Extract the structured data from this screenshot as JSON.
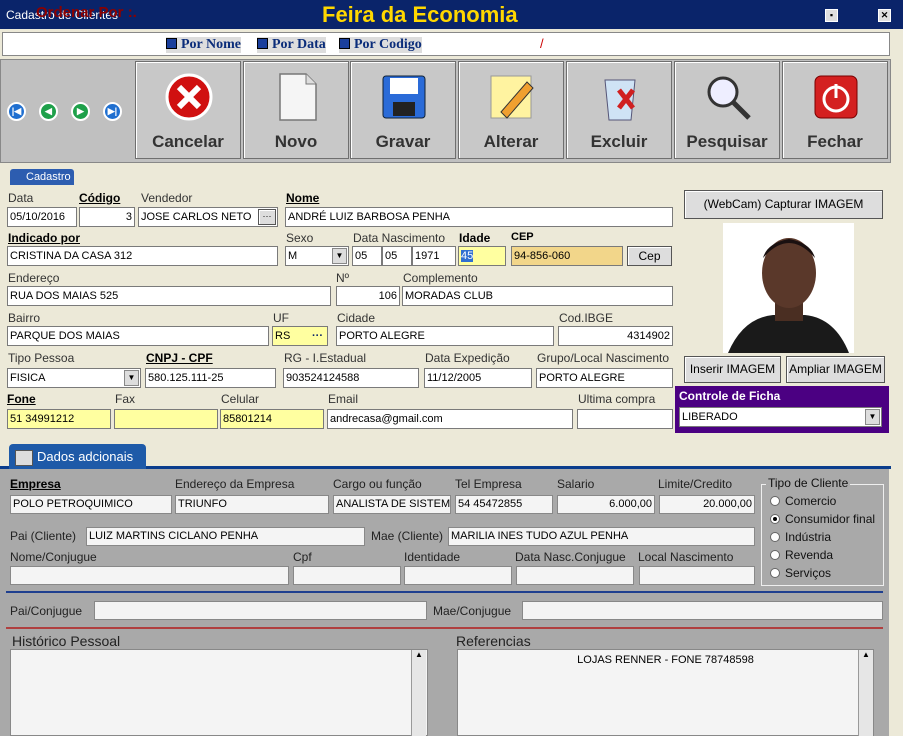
{
  "window": {
    "title": "Cadastro de Clientes",
    "banner": "Feira da Economia",
    "btn_restore": "▪",
    "btn_close": "✕"
  },
  "order": {
    "label": "Ordenar  Por :.",
    "options": [
      "Por Nome",
      "Por Data",
      "Por Codigo"
    ],
    "slash": "/"
  },
  "nav": {
    "first": "|◀",
    "prev": "◀",
    "next": "▶",
    "last": "▶|"
  },
  "toolbar": {
    "cancel": "Cancelar",
    "new": "Novo",
    "save": "Gravar",
    "edit": "Alterar",
    "delete": "Excluir",
    "search": "Pesquisar",
    "close": "Fechar"
  },
  "tab1": "Cadastro",
  "form": {
    "data_label": "Data",
    "data": "05/10/2016",
    "codigo_label": "Código",
    "codigo": "3",
    "vendedor_label": "Vendedor",
    "vendedor": "JOSE CARLOS NETO",
    "ellipsis": "···",
    "nome_label": "Nome",
    "nome": "ANDRÉ LUIZ BARBOSA PENHA",
    "indicado_label": "Indicado por",
    "indicado": "CRISTINA DA CASA 312",
    "sexo_label": "Sexo",
    "sexo": "M",
    "nasc_label": "Data Nascimento",
    "nasc_d": "05",
    "nasc_m": "05",
    "nasc_y": "1971",
    "idade_label": "Idade",
    "idade": "45",
    "cep_label": "CEP",
    "cep": "94-856-060",
    "cep_btn": "Cep",
    "endereco_label": "Endereço",
    "endereco": "RUA DOS MAIAS 525",
    "num_label": "Nº",
    "num": "106",
    "compl_label": "Complemento",
    "compl": "MORADAS CLUB",
    "bairro_label": "Bairro",
    "bairro": "PARQUE DOS MAIAS",
    "uf_label": "UF",
    "uf": "RS",
    "cidade_label": "Cidade",
    "cidade": "PORTO ALEGRE",
    "ibge_label": "Cod.IBGE",
    "ibge": "4314902",
    "tipo_label": "Tipo Pessoa",
    "tipo": "FISICA",
    "cnpj_label": "CNPJ - CPF",
    "cnpj": "580.125.111-25",
    "rg_label": "RG - I.Estadual",
    "rg": "903524124588",
    "exped_label": "Data Expedição",
    "exped": "11/12/2005",
    "grupo_label": "Grupo/Local Nascimento",
    "grupo": "PORTO ALEGRE",
    "fone_label": "Fone",
    "fone": "51 34991212",
    "fax_label": "Fax",
    "fax": "",
    "celular_label": "Celular",
    "celular": "85801214",
    "email_label": "Email",
    "email": "andrecasa@gmail.com",
    "ultima_label": "Ultima compra",
    "ultima": ""
  },
  "photo": {
    "capture": "(WebCam) Capturar IMAGEM",
    "insert": "Inserir IMAGEM",
    "enlarge": "Ampliar IMAGEM"
  },
  "ficha": {
    "label": "Controle de Ficha",
    "value": "LIBERADO"
  },
  "tab2": "Dados adcionais",
  "extra": {
    "empresa_label": "Empresa",
    "empresa": "POLO PETROQUIMICO",
    "end_emp_label": "Endereço da Empresa",
    "end_emp": "TRIUNFO",
    "cargo_label": "Cargo ou função",
    "cargo": "ANALISTA DE SISTEMAS",
    "tel_emp_label": "Tel Empresa",
    "tel_emp": "54 45472855",
    "salario_label": "Salario",
    "salario": "6.000,00",
    "limite_label": "Limite/Credito",
    "limite": "20.000,00",
    "pai_label": "Pai  (Cliente)",
    "pai": "LUIZ MARTINS CICLANO PENHA",
    "mae_label": "Mae (Cliente)",
    "mae": "MARILIA INES TUDO AZUL PENHA",
    "conj_label": "Nome/Conjugue",
    "conj": "",
    "cpf_label": "Cpf",
    "cpf": "",
    "ident_label": "Identidade",
    "ident": "",
    "nasc_conj_label": "Data Nasc.Conjugue",
    "nasc_conj": "",
    "local_label": "Local Nascimento",
    "local": "",
    "pai_conj_label": "Pai/Conjugue",
    "pai_conj": "",
    "mae_conj_label": "Mae/Conjugue",
    "mae_conj": "",
    "hist_label": "Histórico Pessoal",
    "hist": "",
    "ref_label": "Referencias",
    "ref": "LOJAS RENNER - FONE 78748598"
  },
  "tipo_cliente": {
    "label": "Tipo de Cliente",
    "options": [
      "Comercio",
      "Consumidor final",
      "Indústria",
      "Revenda",
      "Serviços"
    ],
    "selected": 1
  },
  "colors": {
    "title": "#0a246a",
    "banner": "#ffd700",
    "tab": "#1e5aa8",
    "ficha": "#4b0082",
    "yellow": "#ffffa0"
  }
}
